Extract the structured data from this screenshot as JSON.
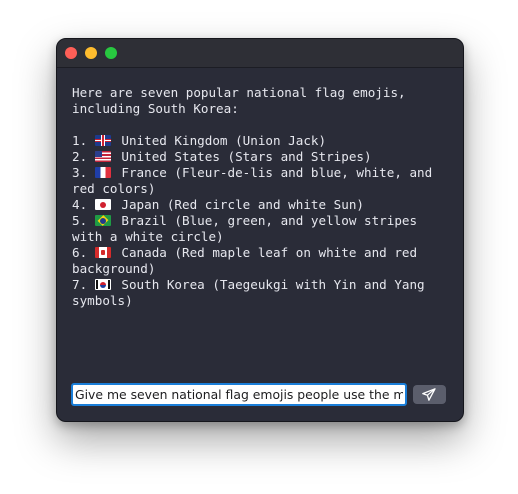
{
  "window": {
    "controls": [
      "close",
      "minimize",
      "zoom"
    ]
  },
  "message": {
    "intro": "Here are seven popular national flag emojis, including South Korea:",
    "items": [
      {
        "num": "1.",
        "flag_icon": "uk-flag-icon",
        "text": "United Kingdom (Union Jack)"
      },
      {
        "num": "2.",
        "flag_icon": "us-flag-icon",
        "text": "United States (Stars and Stripes)"
      },
      {
        "num": "3.",
        "flag_icon": "france-flag-icon",
        "text": "France (Fleur-de-lis and blue, white, and red colors)"
      },
      {
        "num": "4.",
        "flag_icon": "japan-flag-icon",
        "text": "Japan (Red circle and white Sun)"
      },
      {
        "num": "5.",
        "flag_icon": "brazil-flag-icon",
        "text": "Brazil (Blue, green, and yellow stripes with a white circle)"
      },
      {
        "num": "6.",
        "flag_icon": "canada-flag-icon",
        "text": "Canada (Red maple leaf on white and red background)"
      },
      {
        "num": "7.",
        "flag_icon": "south-korea-flag-icon",
        "text": "South Korea (Taegeukgi with Yin and Yang symbols)"
      }
    ]
  },
  "composer": {
    "value": "Give me seven national flag emojis people use the mos",
    "send_icon": "paper-plane-icon"
  },
  "colors": {
    "background": "#2a2c38",
    "text": "#e6e7ee",
    "input_focus": "#1a7ed8",
    "send_button": "#5b5e6c"
  }
}
